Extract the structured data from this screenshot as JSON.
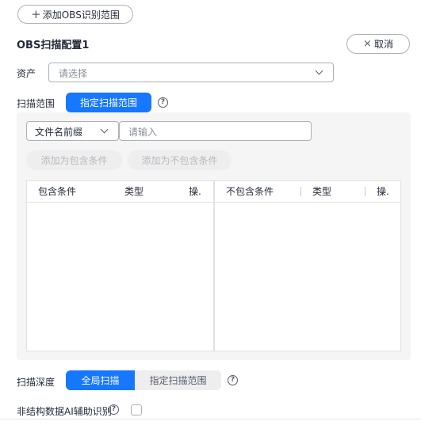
{
  "add_scope_button": {
    "icon": "+",
    "label": "添加OBS识别范围"
  },
  "config": {
    "title": "OBS扫描配置1",
    "cancel": {
      "icon": "×",
      "label": "取消"
    }
  },
  "asset": {
    "label": "资产",
    "placeholder": "请选择"
  },
  "scan_scope": {
    "label": "扫描范围",
    "mode_button": "指定扫描范围",
    "filter": {
      "type_value": "文件名前缀",
      "input_placeholder": "请输入"
    },
    "actions": {
      "add_include": "添加为包含条件",
      "add_exclude": "添加为不包含条件"
    },
    "include_table": {
      "columns": [
        "包含条件",
        "类型",
        "操."
      ]
    },
    "exclude_table": {
      "columns": [
        "不包含条件",
        "类型",
        "操."
      ]
    }
  },
  "scan_depth": {
    "label": "扫描深度",
    "options": [
      "全局扫描",
      "指定扫描范围"
    ],
    "selected": "全局扫描"
  },
  "ai_assist": {
    "label": "非结构数据AI辅助识别",
    "checked": false
  },
  "colors": {
    "primary": "#1677ff",
    "panel_bg": "#f5f5f5",
    "border": "#adb0b8"
  }
}
